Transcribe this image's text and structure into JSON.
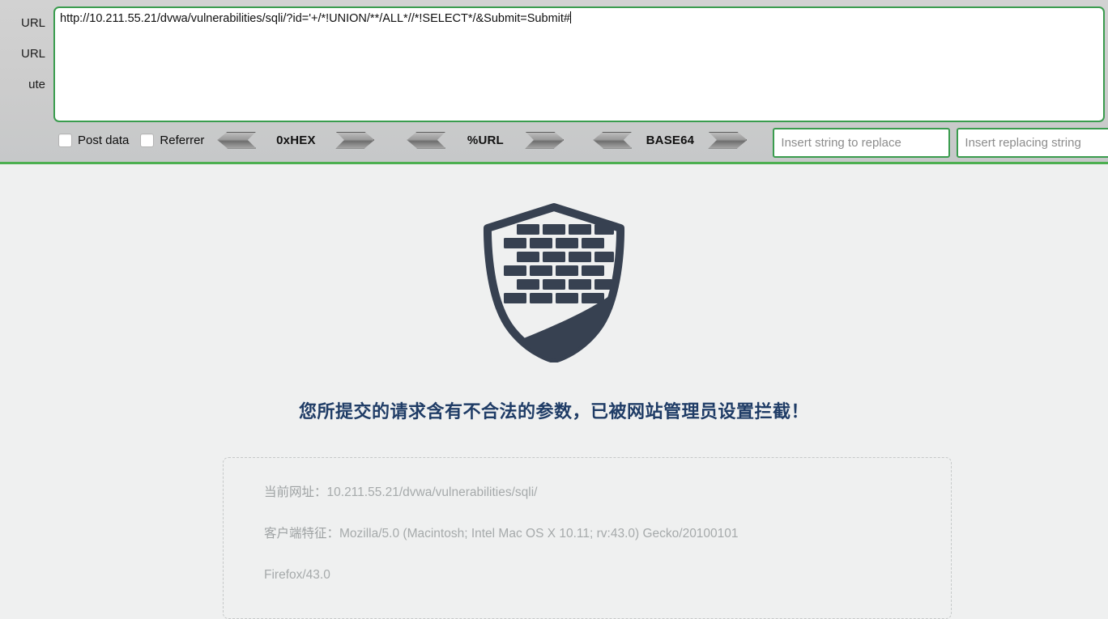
{
  "hackbar": {
    "side_labels": [
      "URL",
      "URL",
      "ute"
    ],
    "url_field": {
      "value": "http://10.211.55.21/dvwa/vulnerabilities/sqli/?id='+/*!UNION/**/ALL*//*!SELECT*/&Submit=Submit#"
    },
    "checkboxes": [
      {
        "label": "Post data",
        "checked": false
      },
      {
        "label": "Referrer",
        "checked": false
      }
    ],
    "encoders": [
      {
        "label": "0xHEX"
      },
      {
        "label": "%URL"
      },
      {
        "label": "BASE64"
      }
    ],
    "replace_inputs": [
      {
        "placeholder": "Insert string to replace",
        "value": ""
      },
      {
        "placeholder": "Insert replacing string",
        "value": ""
      }
    ],
    "accent_green": "#3a9c4e",
    "toolbar_bg": "#cccccc"
  },
  "blocked_page": {
    "logo": "firewall-shield-brick-icon",
    "logo_color": "#374151",
    "title": "您所提交的请求含有不合法的参数，已被网站管理员设置拦截！",
    "title_color": "#1f3c66",
    "details": [
      {
        "key": "当前网址：",
        "value": "10.211.55.21/dvwa/vulnerabilities/sqli/"
      },
      {
        "key": "客户端特征：",
        "value": "Mozilla/5.0 (Macintosh; Intel Mac OS X 10.11; rv:43.0) Gecko/20100101"
      },
      {
        "key": "",
        "value": "Firefox/43.0"
      }
    ],
    "background": "#eff0f0"
  }
}
